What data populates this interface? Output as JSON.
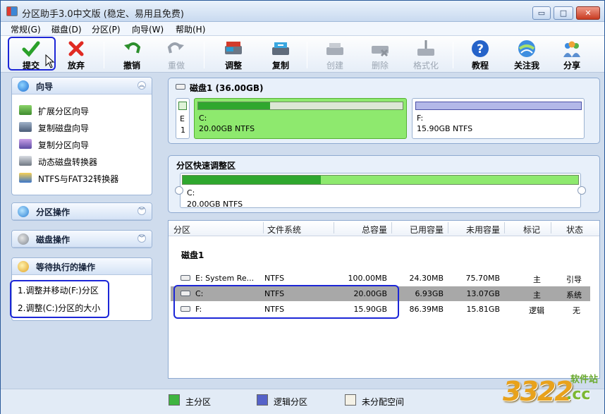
{
  "window": {
    "title": "分区助手3.0中文版 (稳定、易用且免费)"
  },
  "title_buttons": {
    "minimize": "▭",
    "maximize": "□",
    "close": "✕"
  },
  "menu": [
    "常规(G)",
    "磁盘(D)",
    "分区(P)",
    "向导(W)",
    "帮助(H)"
  ],
  "toolbar": [
    {
      "label": "提交",
      "icon": "check-icon",
      "enabled": true
    },
    {
      "label": "放弃",
      "icon": "cross-icon",
      "enabled": true
    },
    {
      "label": "撤销",
      "icon": "undo-icon",
      "enabled": true
    },
    {
      "label": "重做",
      "icon": "redo-icon",
      "enabled": false
    },
    {
      "label": "调整",
      "icon": "resize-icon",
      "enabled": true
    },
    {
      "label": "复制",
      "icon": "copy-icon",
      "enabled": true
    },
    {
      "label": "创建",
      "icon": "create-icon",
      "enabled": false
    },
    {
      "label": "删除",
      "icon": "delete-icon",
      "enabled": false
    },
    {
      "label": "格式化",
      "icon": "format-icon",
      "enabled": false
    },
    {
      "label": "教程",
      "icon": "help-icon",
      "enabled": true
    },
    {
      "label": "关注我",
      "icon": "follow-icon",
      "enabled": true
    },
    {
      "label": "分享",
      "icon": "share-icon",
      "enabled": true
    }
  ],
  "wizard_panel": {
    "title": "向导",
    "items": [
      "扩展分区向导",
      "复制磁盘向导",
      "复制分区向导",
      "动态磁盘转换器",
      "NTFS与FAT32转换器"
    ]
  },
  "partition_ops_panel": {
    "title": "分区操作"
  },
  "disk_ops_panel": {
    "title": "磁盘操作"
  },
  "pending_panel": {
    "title": "等待执行的操作",
    "items": [
      "1.调整并移动(F:)分区",
      "2.调整(C:)分区的大小"
    ]
  },
  "disk_map": {
    "title": "磁盘1 (36.00GB)",
    "small_part": {
      "letter": "E",
      "number": "1"
    },
    "parts": [
      {
        "name": "C:",
        "size": "20.00GB NTFS",
        "used_fraction": 0.35
      },
      {
        "name": "F:",
        "size": "15.90GB NTFS",
        "used_fraction": 0.0
      }
    ]
  },
  "quick_resize": {
    "title": "分区快速调整区",
    "name": "C:",
    "size": "20.00GB NTFS",
    "used_fraction": 0.35
  },
  "table": {
    "headers": [
      "分区",
      "文件系统",
      "总容量",
      "已用容量",
      "未用容量",
      "标记",
      "状态"
    ],
    "group": "磁盘1",
    "rows": [
      {
        "part": "E:  System Re...",
        "fs": "NTFS",
        "total": "100.00MB",
        "used": "24.30MB",
        "free": "75.70MB",
        "flag": "主",
        "status": "引导"
      },
      {
        "part": "C:",
        "fs": "NTFS",
        "total": "20.00GB",
        "used": "6.93GB",
        "free": "13.07GB",
        "flag": "主",
        "status": "系统"
      },
      {
        "part": "F:",
        "fs": "NTFS",
        "total": "15.90GB",
        "used": "86.39MB",
        "free": "15.81GB",
        "flag": "逻辑",
        "status": "无"
      }
    ]
  },
  "legend": [
    "主分区",
    "逻辑分区",
    "未分配空间"
  ],
  "watermark": {
    "text": "3322",
    "suffix": ".cc",
    "site": "软件站"
  },
  "colors": {
    "primary": "#3fb440",
    "logical": "#5562c9",
    "unallocated": "#f4f1e6",
    "highlight": "#1c26d7"
  }
}
